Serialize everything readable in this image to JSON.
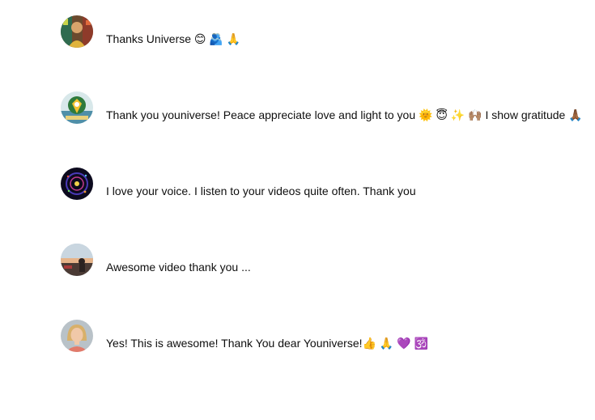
{
  "comments": [
    {
      "author_avatar": "avatar-colorful-portrait",
      "text": "Thanks Universe 😊 🫂 🙏"
    },
    {
      "author_avatar": "avatar-crest-emblem",
      "text": "Thank you youniverse! Peace appreciate love and light to you 🌞 😇 ✨ 🙌🏽 I show gratitude 🙏🏾"
    },
    {
      "author_avatar": "avatar-cosmic-mandala",
      "text": "I love your voice. I listen to your videos quite often. Thank you"
    },
    {
      "author_avatar": "avatar-sunset-landscape",
      "text": "Awesome video thank you ..."
    },
    {
      "author_avatar": "avatar-blonde-woman",
      "text": "Yes! This is awesome! Thank You dear Youniverse!👍 🙏 💜 🕉️"
    }
  ],
  "colors": {
    "text": "#0f0f0f",
    "background": "#ffffff"
  }
}
